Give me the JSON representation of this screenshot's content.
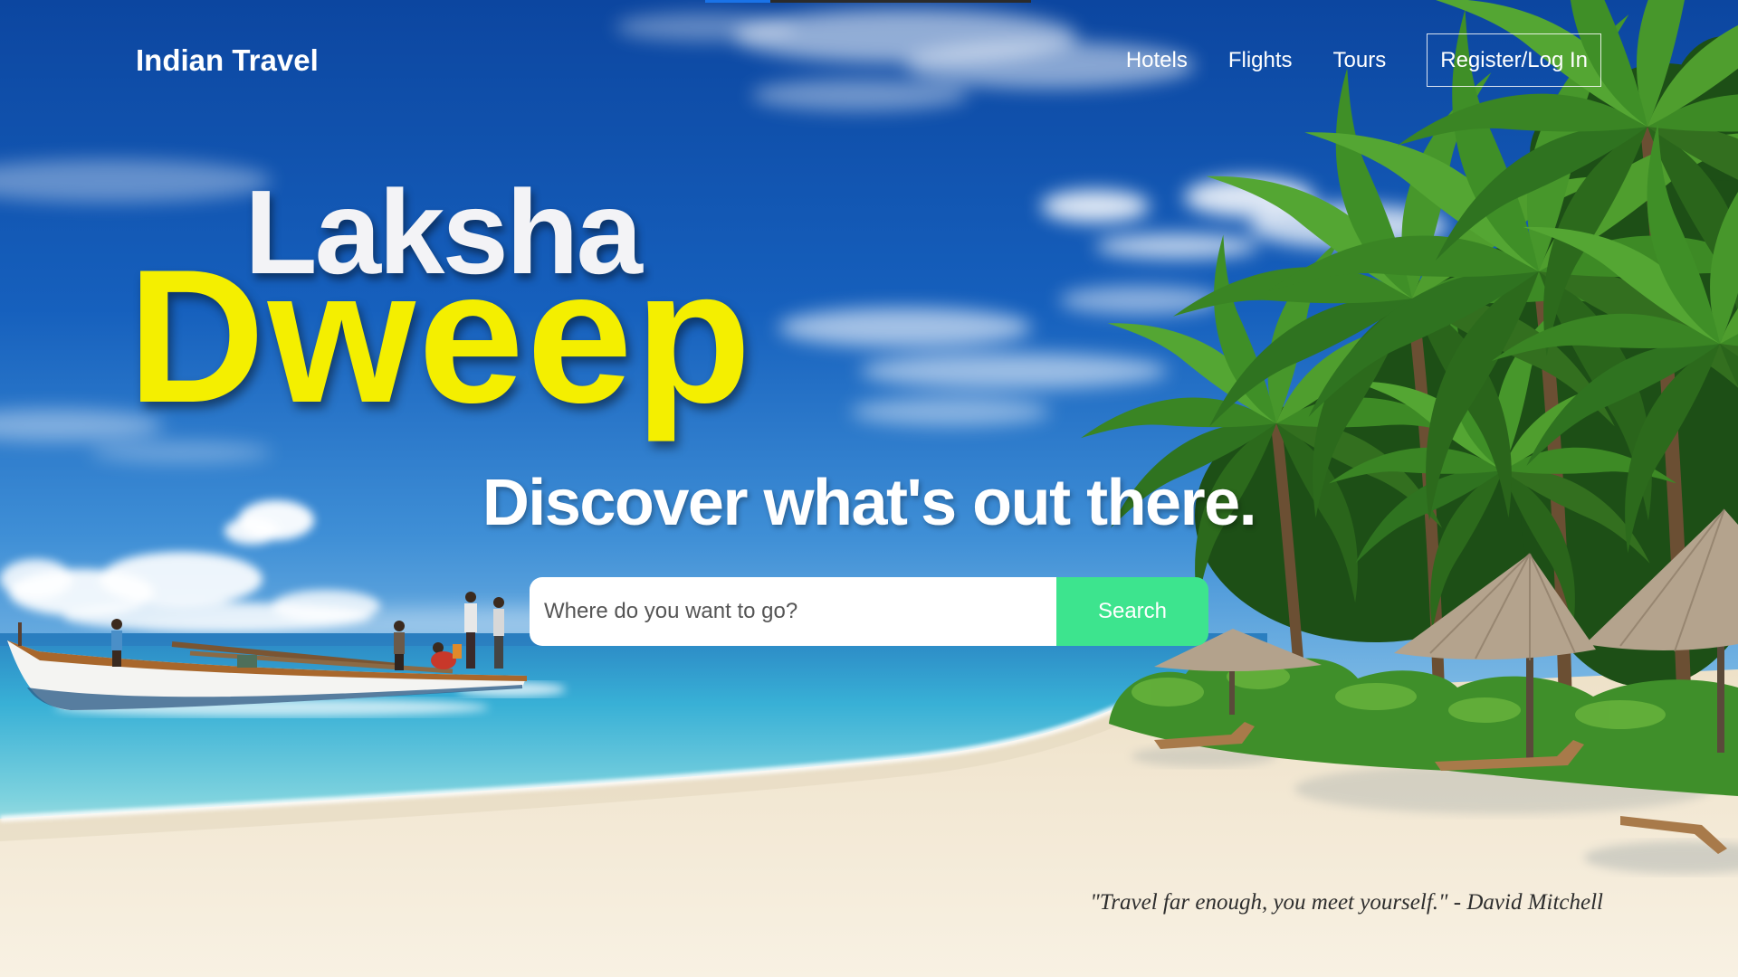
{
  "loading_bar": {
    "progress": 0.2
  },
  "navbar": {
    "brand": "Indian Travel",
    "links": [
      {
        "label": "Hotels"
      },
      {
        "label": "Flights"
      },
      {
        "label": "Tours"
      }
    ],
    "auth_button": "Register/Log In"
  },
  "hero": {
    "logo": {
      "line1": "Laksha",
      "line2": "Dweep"
    },
    "headline": "Discover what's out there.",
    "search": {
      "placeholder": "Where do you want to go?",
      "value": "",
      "button_label": "Search"
    }
  },
  "quote": "\"Travel far enough, you meet yourself.\" - David Mitchell",
  "colors": {
    "accent": "#3de48e",
    "logo_yellow": "#f4ef00",
    "logo_white": "#f3f3f6",
    "text": "#ffffff",
    "quote_text": "#2e2e2e",
    "loading_bar": "#1a73e8",
    "loading_track": "#2b2b2b"
  }
}
